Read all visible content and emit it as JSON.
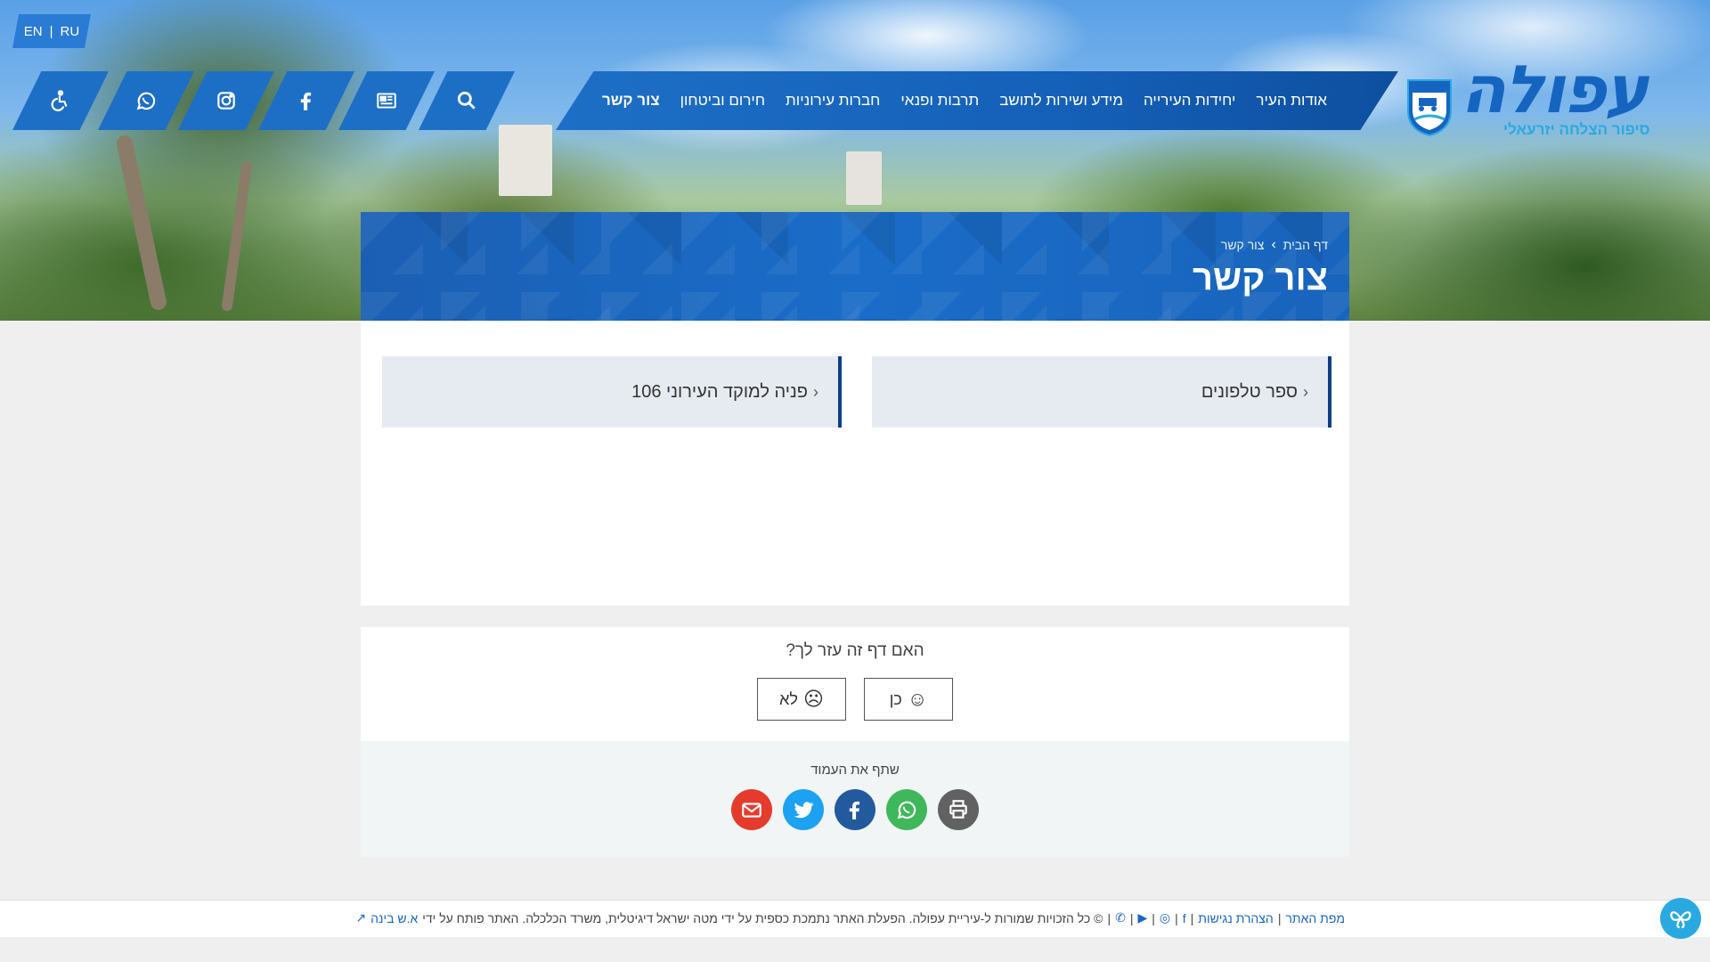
{
  "lang_switch": {
    "items": [
      "EN",
      "RU"
    ],
    "separator": "|"
  },
  "nav": {
    "items": [
      {
        "label": "אודות העיר"
      },
      {
        "label": "יחידות העירייה"
      },
      {
        "label": "מידע ושירות לתושב"
      },
      {
        "label": "תרבות ופנאי"
      },
      {
        "label": "חברות עירוניות"
      },
      {
        "label": "חירום וביטחון"
      },
      {
        "label": "צור קשר",
        "active": true
      }
    ],
    "icons": [
      "search-icon",
      "newspaper-icon",
      "facebook-icon",
      "instagram-icon",
      "whatsapp-icon",
      "accessibility-icon"
    ]
  },
  "logo": {
    "wordmark": "עפולה",
    "tagline": "סיפור הצלחה יזרעאלי"
  },
  "breadcrumb": {
    "home": "דף הבית",
    "current": "צור קשר",
    "separator": "›"
  },
  "page_title": "צור קשר",
  "cards": [
    {
      "label": "ספר טלפונים",
      "icon": "chevron-left-icon"
    },
    {
      "label": "פניה למוקד העירוני 106",
      "icon": "chevron-left-icon"
    }
  ],
  "feedback": {
    "question": "האם דף זה עזר לך?",
    "yes": "כן",
    "no": "לא"
  },
  "share": {
    "label": "שתף את העמוד",
    "buttons": [
      "print-icon",
      "whatsapp-icon",
      "facebook-icon",
      "twitter-icon",
      "email-icon"
    ],
    "colors": {
      "print": "#616161",
      "whatsapp": "#3eb85b",
      "facebook": "#235a9e",
      "twitter": "#1da1f2",
      "email": "#e43b2c"
    }
  },
  "footer": {
    "site_map": "מפת האתר",
    "accessibility_statement": "הצהרת נגישות",
    "copyright": "© כל הזכויות שמורות ל-עיריית עפולה. הפעלת האתר נתמכת כספית על ידי מטה ישראל דיגיטלית, משרד הכלכלה. האתר פותח על ידי",
    "developer": "א.ש בינה",
    "sep": "|"
  },
  "colors": {
    "brand_blue": "#1b65c3",
    "dark_blue": "#0d3f84",
    "accent_cyan": "#2aa9e0"
  }
}
